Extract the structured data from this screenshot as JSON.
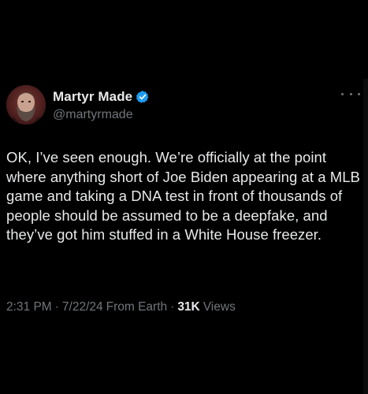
{
  "tweet": {
    "display_name": "Martyr Made",
    "handle": "@martyrmade",
    "verified": true,
    "text": "OK, I’ve seen enough. We’re officially at the point where anything short of Joe Biden appearing at a MLB game and taking a DNA test in front of thousands of people should be assumed to be a deepfake, and they’ve got him stuffed in a White House freezer.",
    "time": "2:31 PM",
    "date": "7/22/24",
    "source": "From Earth",
    "separator": "·",
    "views_count": "31K",
    "views_label": "Views"
  },
  "icons": {
    "verified": "verified-badge-icon",
    "more": "more-horizontal-icon",
    "avatar": "avatar-image"
  },
  "colors": {
    "background": "#000000",
    "text_primary": "#e7e9ea",
    "text_secondary": "#71767b",
    "verified_blue": "#1d9bf0"
  }
}
